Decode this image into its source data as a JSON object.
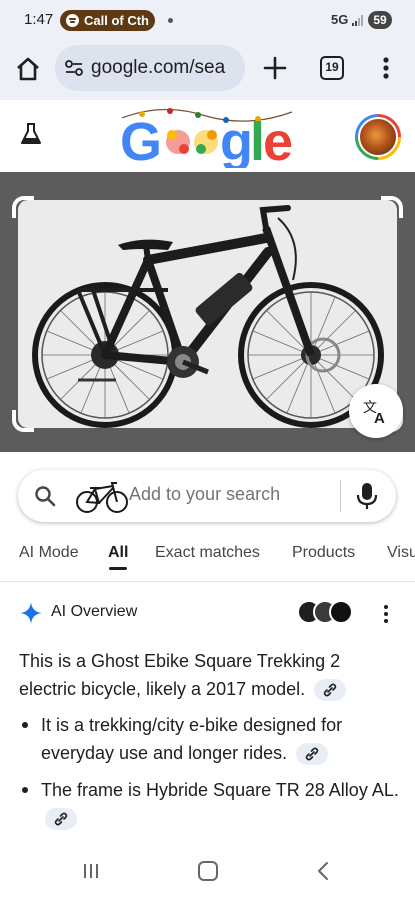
{
  "status_bar": {
    "time": "1:47",
    "media_label": "Call of Cth",
    "network": "5G",
    "battery": "59"
  },
  "browser": {
    "url": "google.com/sea",
    "tab_count": "19"
  },
  "google": {
    "logo_text": "Google",
    "logo_colors": [
      "#4285f4",
      "#ea4335",
      "#fbbc05",
      "#4285f4",
      "#34a853",
      "#ea4335"
    ]
  },
  "search": {
    "placeholder": "Add to your search"
  },
  "tabs": [
    {
      "label": "AI Mode",
      "active": false
    },
    {
      "label": "All",
      "active": true
    },
    {
      "label": "Exact matches",
      "active": false
    },
    {
      "label": "Products",
      "active": false
    },
    {
      "label": "Visu",
      "active": false
    }
  ],
  "ai_overview": {
    "title": "AI Overview",
    "summary": "This is a Ghost Ebike Square Trekking 2 electric bicycle, likely a 2017 model.",
    "bullets": [
      "It is a trekking/city e-bike designed for everyday use and longer rides.",
      "The frame is Hybride Square TR 28 Alloy AL."
    ]
  },
  "icons": {
    "home": "home-icon",
    "tune": "tune-icon",
    "new_tab": "plus-icon",
    "menu": "more-vert-icon",
    "labs": "flask-icon",
    "translate": "translate-icon",
    "search": "search-icon",
    "mic": "mic-icon",
    "ai": "sparkle-icon",
    "link": "link-icon"
  },
  "colors": {
    "accent": "#1a73e8",
    "media_pill": "#5d3a13",
    "chrome_bg": "#eef0f7"
  }
}
